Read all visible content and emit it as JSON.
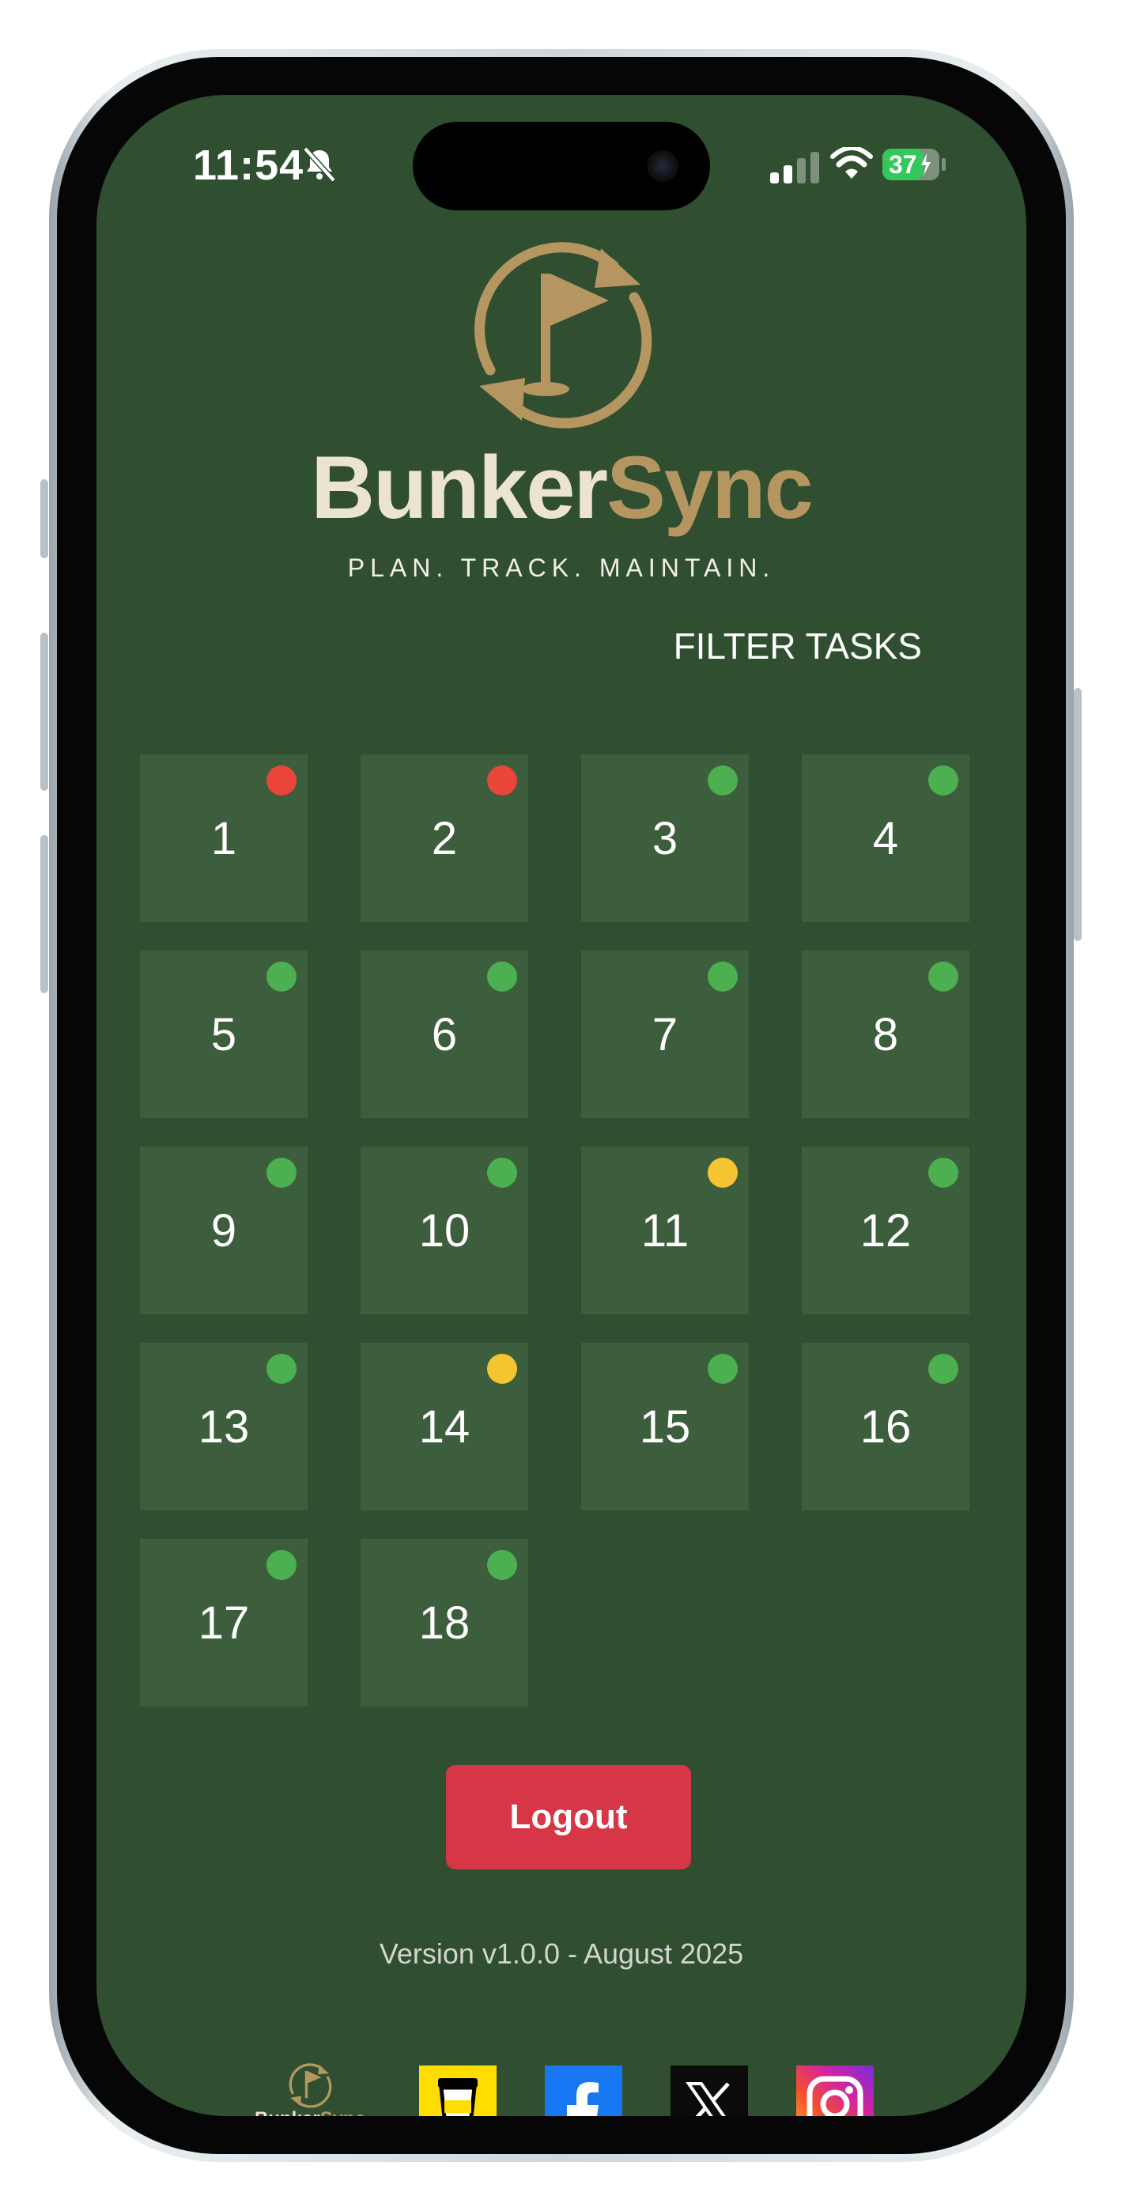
{
  "status_bar": {
    "time": "11:54",
    "battery": "37"
  },
  "brand": {
    "name_part1": "Bunker",
    "name_part2": "Sync",
    "tagline": "PLAN. TRACK. MAINTAIN.",
    "colors": {
      "light": "#ece3d0",
      "gold": "#b59661"
    }
  },
  "filter_label": "FILTER TASKS",
  "holes": [
    {
      "label": "1",
      "status_color": "#e9453b"
    },
    {
      "label": "2",
      "status_color": "#e9453b"
    },
    {
      "label": "3",
      "status_color": "#4caf50"
    },
    {
      "label": "4",
      "status_color": "#4caf50"
    },
    {
      "label": "5",
      "status_color": "#4caf50"
    },
    {
      "label": "6",
      "status_color": "#4caf50"
    },
    {
      "label": "7",
      "status_color": "#4caf50"
    },
    {
      "label": "8",
      "status_color": "#4caf50"
    },
    {
      "label": "9",
      "status_color": "#4caf50"
    },
    {
      "label": "10",
      "status_color": "#4caf50"
    },
    {
      "label": "11",
      "status_color": "#f5c431"
    },
    {
      "label": "12",
      "status_color": "#4caf50"
    },
    {
      "label": "13",
      "status_color": "#4caf50"
    },
    {
      "label": "14",
      "status_color": "#f5c431"
    },
    {
      "label": "15",
      "status_color": "#4caf50"
    },
    {
      "label": "16",
      "status_color": "#4caf50"
    },
    {
      "label": "17",
      "status_color": "#4caf50"
    },
    {
      "label": "18",
      "status_color": "#4caf50"
    }
  ],
  "logout_label": "Logout",
  "version_text": "Version v1.0.0 - August 2025",
  "footer": {
    "socials": [
      {
        "name": "buy-me-a-coffee-icon",
        "color": "#ffdd00"
      },
      {
        "name": "facebook-icon",
        "color": "#1877f2"
      },
      {
        "name": "x-icon",
        "color": "#000000"
      },
      {
        "name": "instagram-icon",
        "color": "#d6249f"
      }
    ]
  }
}
